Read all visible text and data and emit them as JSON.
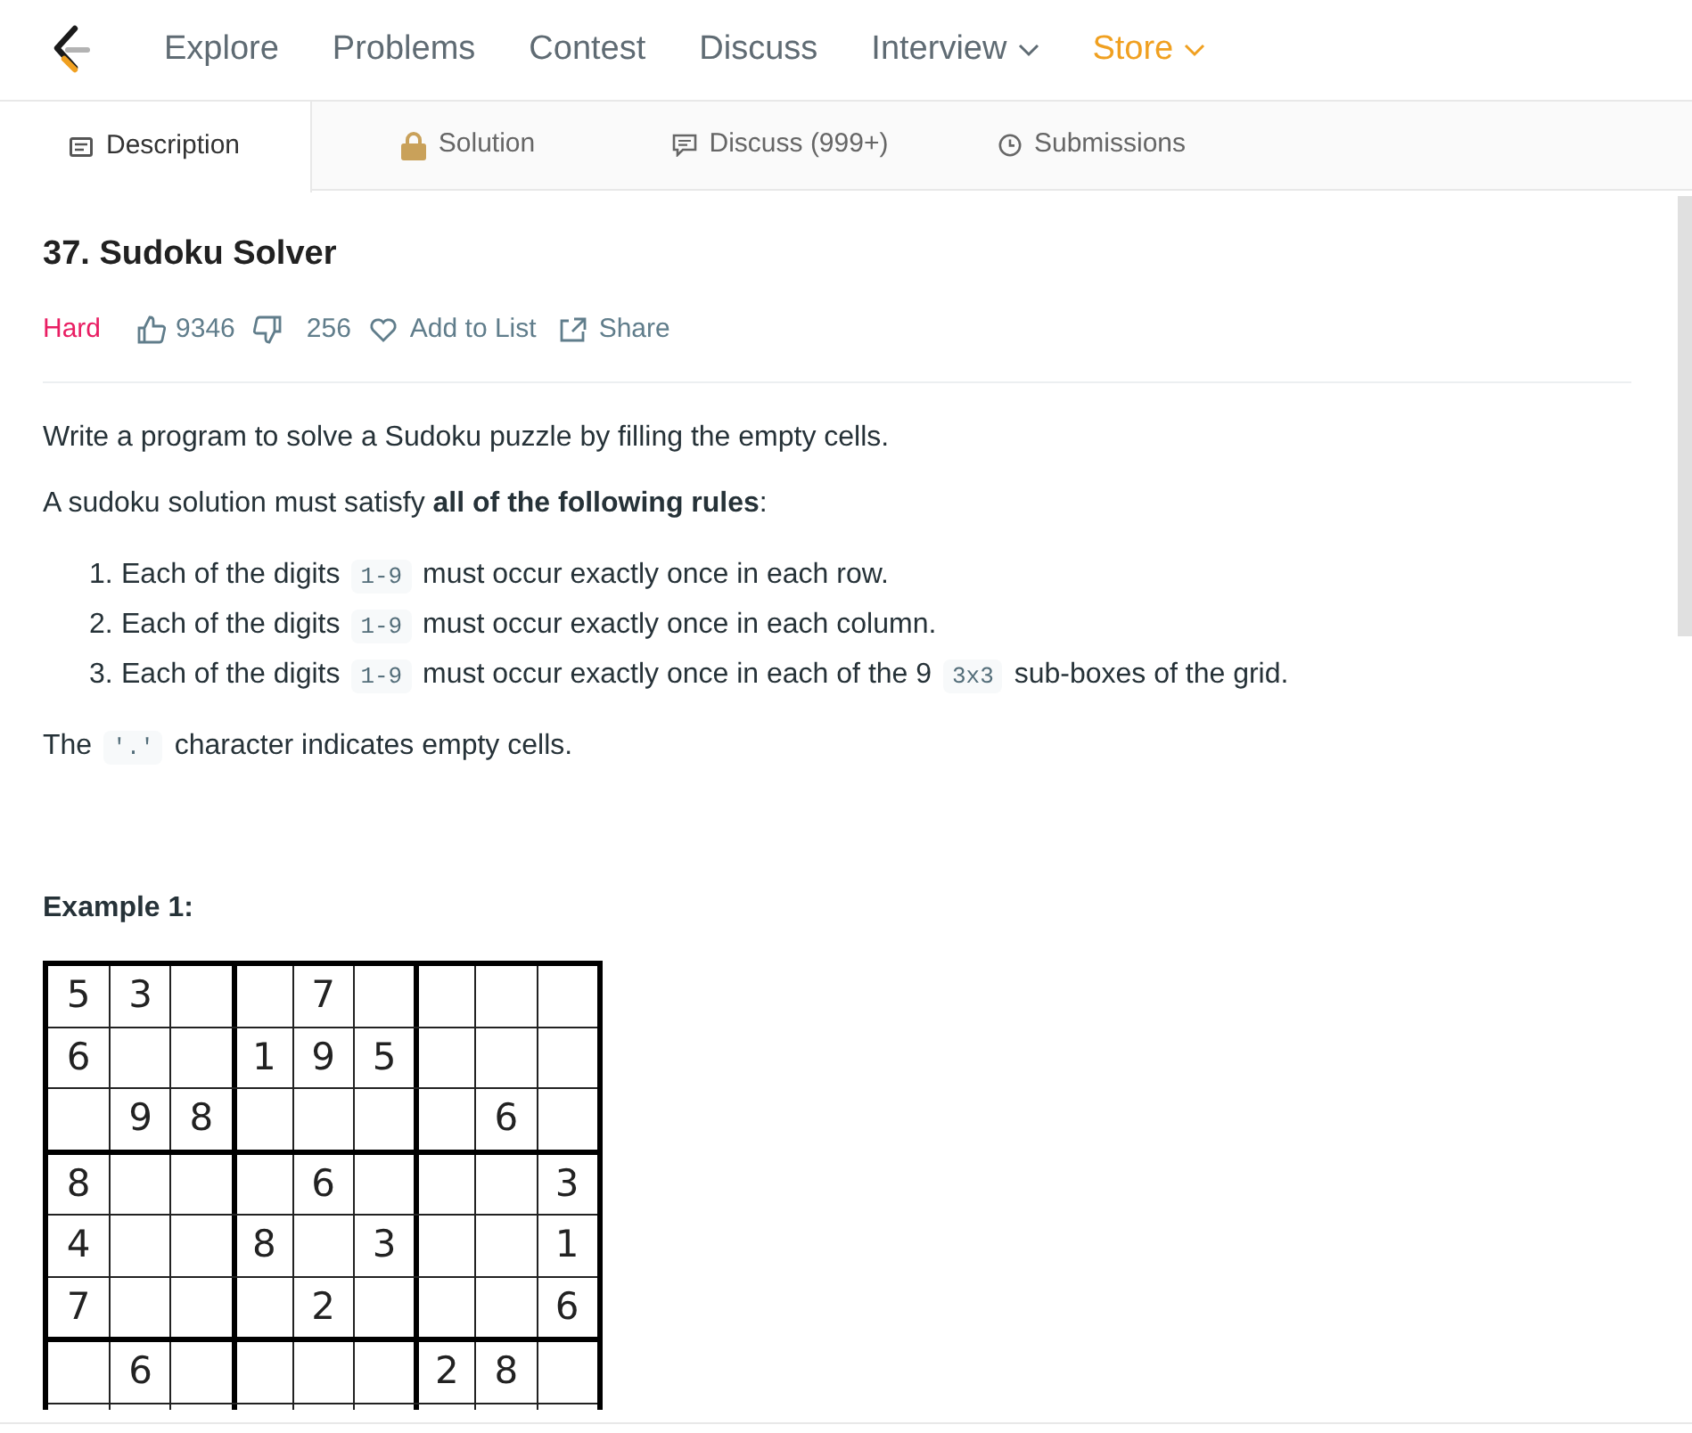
{
  "nav": {
    "items": [
      {
        "label": "Explore",
        "dropdown": false,
        "highlighted": false
      },
      {
        "label": "Problems",
        "dropdown": false,
        "highlighted": false
      },
      {
        "label": "Contest",
        "dropdown": false,
        "highlighted": false
      },
      {
        "label": "Discuss",
        "dropdown": false,
        "highlighted": false
      },
      {
        "label": "Interview",
        "dropdown": true,
        "highlighted": false
      },
      {
        "label": "Store",
        "dropdown": true,
        "highlighted": true
      }
    ]
  },
  "tabs": [
    {
      "label": "Description",
      "selected": true,
      "kind": "description"
    },
    {
      "label": "Solution",
      "selected": false,
      "kind": "locked"
    },
    {
      "label": "Discuss (999+)",
      "selected": false,
      "kind": "discuss"
    },
    {
      "label": "Submissions",
      "selected": false,
      "kind": "history"
    }
  ],
  "problem": {
    "title": "37. Sudoku Solver",
    "difficulty": "Hard",
    "likes": "9346",
    "dislikes": "256",
    "add_to_list": "Add to List",
    "share": "Share"
  },
  "paragraphs": [
    [
      {
        "kind": "text",
        "text": "Write a program to solve a Sudoku puzzle by filling the empty cells."
      }
    ],
    [
      {
        "kind": "text",
        "text": "A sudoku solution must satisfy "
      },
      {
        "kind": "bold",
        "text": "all of the following rules"
      },
      {
        "kind": "text",
        "text": ":"
      }
    ]
  ],
  "rules": [
    {
      "number": "1.",
      "segments": [
        {
          "kind": "text",
          "text": "Each of the digits "
        },
        {
          "kind": "code",
          "text": "1-9"
        },
        {
          "kind": "text",
          "text": " must occur exactly once in each row."
        }
      ]
    },
    {
      "number": "2.",
      "segments": [
        {
          "kind": "text",
          "text": "Each of the digits "
        },
        {
          "kind": "code",
          "text": "1-9"
        },
        {
          "kind": "text",
          "text": " must occur exactly once in each column."
        }
      ]
    },
    {
      "number": "3.",
      "segments": [
        {
          "kind": "text",
          "text": "Each of the digits "
        },
        {
          "kind": "code",
          "text": "1-9"
        },
        {
          "kind": "text",
          "text": " must occur exactly once in each of the 9 "
        },
        {
          "kind": "code",
          "text": "3x3"
        },
        {
          "kind": "text",
          "text": " sub-boxes of the grid."
        }
      ]
    }
  ],
  "note": [
    {
      "kind": "text",
      "text": "The "
    },
    {
      "kind": "code",
      "text": "'.'"
    },
    {
      "kind": "text",
      "text": " character indicates empty cells."
    }
  ],
  "example": {
    "heading": "Example 1:",
    "grid": [
      [
        {
          "kind": "given",
          "value": "5"
        },
        {
          "kind": "given",
          "value": "3"
        },
        {
          "kind": "empty"
        },
        {
          "kind": "empty"
        },
        {
          "kind": "given",
          "value": "7"
        },
        {
          "kind": "empty"
        },
        {
          "kind": "empty"
        },
        {
          "kind": "empty"
        },
        {
          "kind": "empty"
        }
      ],
      [
        {
          "kind": "given",
          "value": "6"
        },
        {
          "kind": "empty"
        },
        {
          "kind": "empty"
        },
        {
          "kind": "given",
          "value": "1"
        },
        {
          "kind": "given",
          "value": "9"
        },
        {
          "kind": "given",
          "value": "5"
        },
        {
          "kind": "empty"
        },
        {
          "kind": "empty"
        },
        {
          "kind": "empty"
        }
      ],
      [
        {
          "kind": "empty"
        },
        {
          "kind": "given",
          "value": "9"
        },
        {
          "kind": "given",
          "value": "8"
        },
        {
          "kind": "empty"
        },
        {
          "kind": "empty"
        },
        {
          "kind": "empty"
        },
        {
          "kind": "empty"
        },
        {
          "kind": "given",
          "value": "6"
        },
        {
          "kind": "empty"
        }
      ],
      [
        {
          "kind": "given",
          "value": "8"
        },
        {
          "kind": "empty"
        },
        {
          "kind": "empty"
        },
        {
          "kind": "empty"
        },
        {
          "kind": "given",
          "value": "6"
        },
        {
          "kind": "empty"
        },
        {
          "kind": "empty"
        },
        {
          "kind": "empty"
        },
        {
          "kind": "given",
          "value": "3"
        }
      ],
      [
        {
          "kind": "given",
          "value": "4"
        },
        {
          "kind": "empty"
        },
        {
          "kind": "empty"
        },
        {
          "kind": "given",
          "value": "8"
        },
        {
          "kind": "empty"
        },
        {
          "kind": "given",
          "value": "3"
        },
        {
          "kind": "empty"
        },
        {
          "kind": "empty"
        },
        {
          "kind": "given",
          "value": "1"
        }
      ],
      [
        {
          "kind": "given",
          "value": "7"
        },
        {
          "kind": "empty"
        },
        {
          "kind": "empty"
        },
        {
          "kind": "empty"
        },
        {
          "kind": "given",
          "value": "2"
        },
        {
          "kind": "empty"
        },
        {
          "kind": "empty"
        },
        {
          "kind": "empty"
        },
        {
          "kind": "given",
          "value": "6"
        }
      ],
      [
        {
          "kind": "empty"
        },
        {
          "kind": "given",
          "value": "6"
        },
        {
          "kind": "empty"
        },
        {
          "kind": "empty"
        },
        {
          "kind": "empty"
        },
        {
          "kind": "empty"
        },
        {
          "kind": "given",
          "value": "2"
        },
        {
          "kind": "given",
          "value": "8"
        },
        {
          "kind": "empty"
        }
      ]
    ]
  }
}
